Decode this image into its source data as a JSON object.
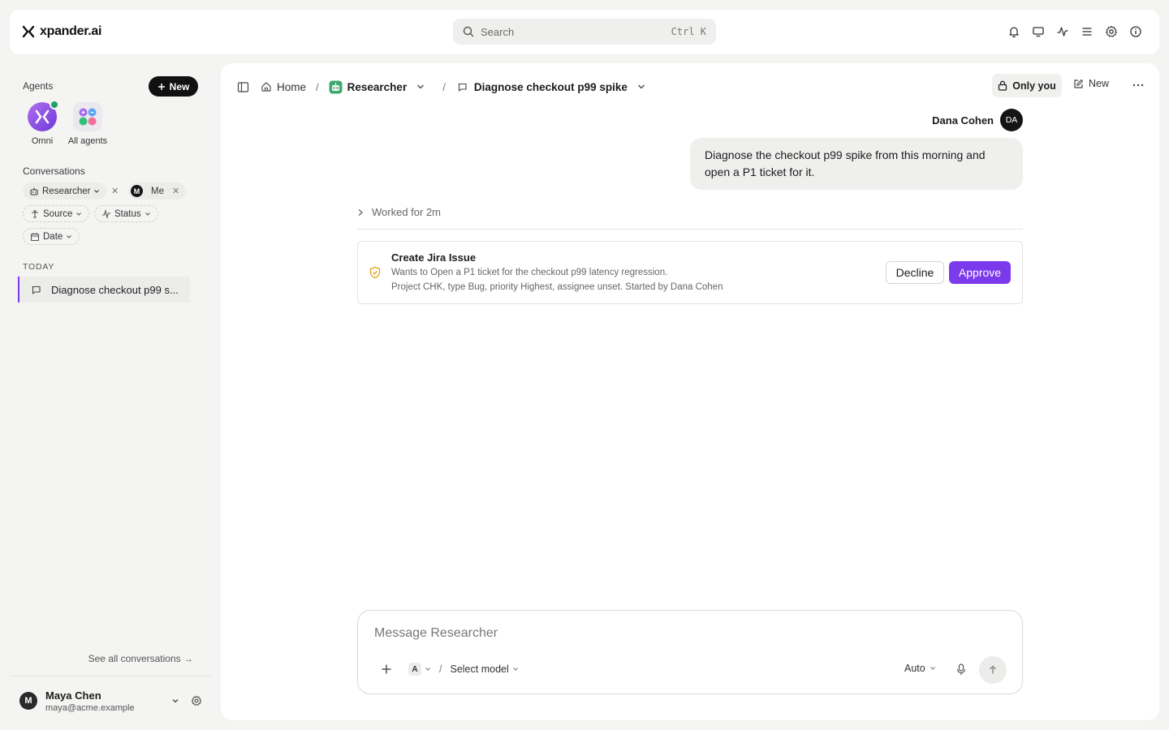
{
  "app": {
    "brand": "xpander.ai",
    "accent": "#7c3aed"
  },
  "search": {
    "placeholder": "Search",
    "shortcut": "Ctrl K"
  },
  "topbar_icons": [
    "bell-icon",
    "monitor-icon",
    "activity-icon",
    "list-icon",
    "settings-icon",
    "info-icon"
  ],
  "sidebar": {
    "agents_title": "Agents",
    "new_label": "New",
    "agents": [
      {
        "label": "Omni",
        "status": "online"
      },
      {
        "label": "All agents"
      }
    ],
    "conversations_title": "Conversations",
    "filters": {
      "agent": "Researcher",
      "user": "Me",
      "user_initial": "M",
      "source": "Source",
      "status": "Status",
      "date": "Date"
    },
    "section_today": "TODAY",
    "conversations": [
      {
        "title": "Diagnose checkout p99 s..."
      }
    ],
    "see_all": "See all conversations →",
    "user": {
      "initial": "M",
      "name": "Maya Chen",
      "email": "maya@acme.example"
    }
  },
  "header": {
    "breadcrumb": {
      "home": "Home",
      "agent": "Researcher",
      "conversation": "Diagnose checkout p99 spike",
      "separator": "/"
    },
    "visibility": "Only you",
    "new_label": "New"
  },
  "message": {
    "sender_name": "Dana Cohen",
    "sender_initials": "DA",
    "text_line1": "Diagnose the checkout p99 spike from this morning and",
    "text_line2": "open a P1 ticket for it."
  },
  "worked": "Worked for 2m",
  "approval": {
    "title": "Create Jira Issue",
    "line1": "Wants to Open a P1 ticket for the checkout p99 latency regression.",
    "line2": "Project CHK, type Bug, priority Highest, assignee unset. Started by Dana Cohen",
    "decline": "Decline",
    "approve": "Approve"
  },
  "composer": {
    "placeholder": "Message Researcher",
    "agent_badge": "A",
    "separator": "/",
    "model": "Select model",
    "mode": "Auto"
  }
}
